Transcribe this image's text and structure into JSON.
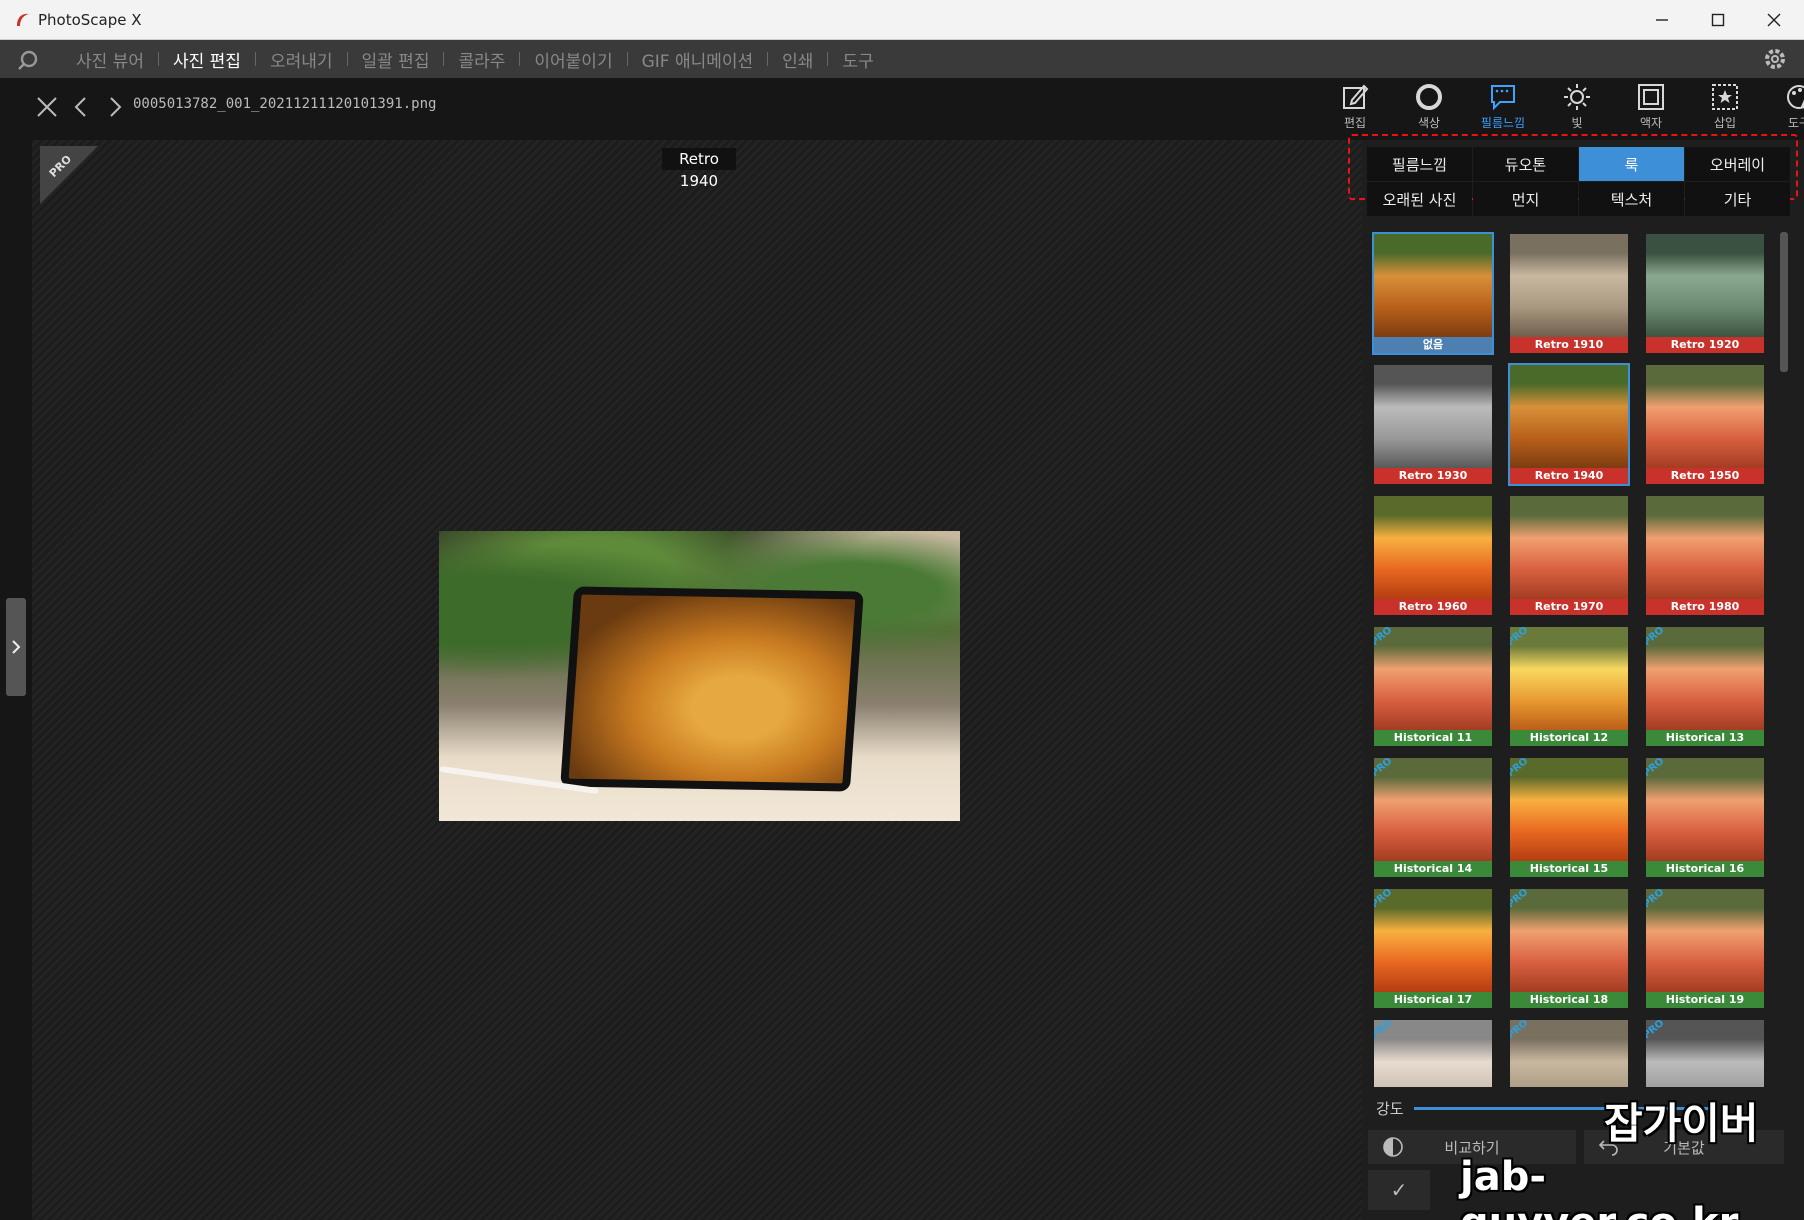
{
  "window": {
    "title": "PhotoScape X",
    "controls": [
      "minimize",
      "maximize",
      "close"
    ]
  },
  "menu": {
    "items": [
      {
        "label": "사진 뷰어",
        "active": false
      },
      {
        "label": "사진 편집",
        "active": true
      },
      {
        "label": "오려내기",
        "active": false
      },
      {
        "label": "일괄 편집",
        "active": false
      },
      {
        "label": "콜라주",
        "active": false
      },
      {
        "label": "이어붙이기",
        "active": false
      },
      {
        "label": "GIF 애니메이션",
        "active": false
      },
      {
        "label": "인쇄",
        "active": false
      },
      {
        "label": "도구",
        "active": false
      }
    ]
  },
  "editor": {
    "filename": "0005013782_001_20211211120101391.png",
    "current_filter": "Retro 1940",
    "pro_badge": "PRO"
  },
  "tools": [
    {
      "label": "편집",
      "icon": "edit-icon",
      "active": false
    },
    {
      "label": "색상",
      "icon": "color-icon",
      "active": false
    },
    {
      "label": "필름느낌",
      "icon": "film-icon",
      "active": true
    },
    {
      "label": "빛",
      "icon": "light-icon",
      "active": false
    },
    {
      "label": "액자",
      "icon": "frame-icon",
      "active": false
    },
    {
      "label": "삽입",
      "icon": "insert-icon",
      "active": false
    },
    {
      "label": "도구",
      "icon": "tools-icon",
      "active": false
    }
  ],
  "categories": [
    {
      "label": "필름느낌",
      "active": false
    },
    {
      "label": "듀오톤",
      "active": false
    },
    {
      "label": "룩",
      "active": true
    },
    {
      "label": "오버레이",
      "active": false
    },
    {
      "label": "오래된 사진",
      "active": false
    },
    {
      "label": "먼지",
      "active": false
    },
    {
      "label": "텍스처",
      "active": false
    },
    {
      "label": "기타",
      "active": false
    }
  ],
  "thumbnails": [
    {
      "label": "없음",
      "cap": "blue",
      "pro": false,
      "tone": "orig",
      "selected": true
    },
    {
      "label": "Retro 1910",
      "cap": "red",
      "pro": false,
      "tone": "sepia",
      "selected": false
    },
    {
      "label": "Retro 1920",
      "cap": "red",
      "pro": false,
      "tone": "green",
      "selected": false
    },
    {
      "label": "Retro 1930",
      "cap": "red",
      "pro": false,
      "tone": "gray",
      "selected": false
    },
    {
      "label": "Retro 1940",
      "cap": "red",
      "pro": false,
      "tone": "orig",
      "selected": true
    },
    {
      "label": "Retro 1950",
      "cap": "red",
      "pro": false,
      "tone": "warm",
      "selected": false
    },
    {
      "label": "Retro 1960",
      "cap": "red",
      "pro": false,
      "tone": "orange",
      "selected": false
    },
    {
      "label": "Retro 1970",
      "cap": "red",
      "pro": false,
      "tone": "warm",
      "selected": false
    },
    {
      "label": "Retro 1980",
      "cap": "red",
      "pro": false,
      "tone": "warm",
      "selected": false
    },
    {
      "label": "Historical 11",
      "cap": "green",
      "pro": true,
      "tone": "warm",
      "selected": false
    },
    {
      "label": "Historical 12",
      "cap": "green",
      "pro": true,
      "tone": "yellow",
      "selected": false
    },
    {
      "label": "Historical 13",
      "cap": "green",
      "pro": true,
      "tone": "warm",
      "selected": false
    },
    {
      "label": "Historical 14",
      "cap": "green",
      "pro": true,
      "tone": "warm",
      "selected": false
    },
    {
      "label": "Historical 15",
      "cap": "green",
      "pro": true,
      "tone": "orange",
      "selected": false
    },
    {
      "label": "Historical 16",
      "cap": "green",
      "pro": true,
      "tone": "warm",
      "selected": false
    },
    {
      "label": "Historical 17",
      "cap": "green",
      "pro": true,
      "tone": "orange",
      "selected": false
    },
    {
      "label": "Historical 18",
      "cap": "green",
      "pro": true,
      "tone": "warm",
      "selected": false
    },
    {
      "label": "Historical 19",
      "cap": "green",
      "pro": true,
      "tone": "warm",
      "selected": false
    },
    {
      "label": "",
      "cap": "none",
      "pro": true,
      "tone": "pale",
      "selected": false
    },
    {
      "label": "",
      "cap": "none",
      "pro": true,
      "tone": "sepia",
      "selected": false
    },
    {
      "label": "",
      "cap": "none",
      "pro": true,
      "tone": "gray",
      "selected": false
    }
  ],
  "panel": {
    "strength_label": "강도",
    "compare_label": "비교하기",
    "default_label": "기본값",
    "apply_label": "✓"
  },
  "watermark": {
    "line1": "잡가이버",
    "line2": "jab-guyver.co.kr"
  },
  "colors": {
    "accent": "#3d8fd8",
    "highlight_frame": "#e11111",
    "caption_red": "#c8322a",
    "caption_green": "#3a8a3a"
  }
}
